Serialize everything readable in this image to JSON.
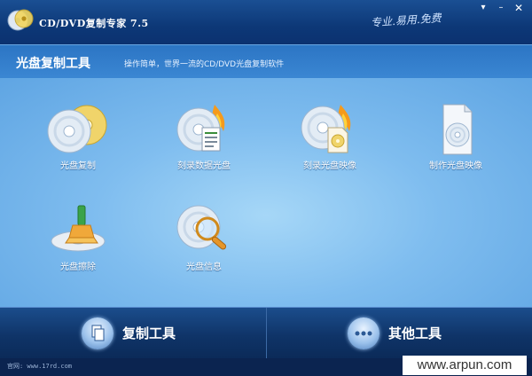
{
  "window": {
    "title": "CD/DVD复制专家 7.5",
    "slogan": "专业.易用.免费",
    "controls": {
      "menu": "▾",
      "minimize": "–",
      "close": "✕"
    }
  },
  "header": {
    "title": "光盘复制工具",
    "subtitle": "操作简单，世界一流的CD/DVD光盘复制软件"
  },
  "tools": [
    {
      "label": "光盘复制",
      "icon": "disc-copy-icon"
    },
    {
      "label": "刻录数据光盘",
      "icon": "burn-data-disc-icon"
    },
    {
      "label": "刻录光盘映像",
      "icon": "burn-image-icon"
    },
    {
      "label": "制作光盘映像",
      "icon": "make-image-icon"
    },
    {
      "label": "光盘擦除",
      "icon": "disc-erase-icon"
    },
    {
      "label": "光盘信息",
      "icon": "disc-info-icon"
    }
  ],
  "bottom_tabs": [
    {
      "label": "复制工具",
      "icon": "copy-tool-icon"
    },
    {
      "label": "其他工具",
      "icon": "other-tools-icon"
    }
  ],
  "status": {
    "text": "官网: www.17rd.com"
  },
  "watermark": "www.arpun.com",
  "colors": {
    "title_bar": "#0e3b78",
    "content": "#7fbdef",
    "bottom_bar": "#0f3468"
  }
}
